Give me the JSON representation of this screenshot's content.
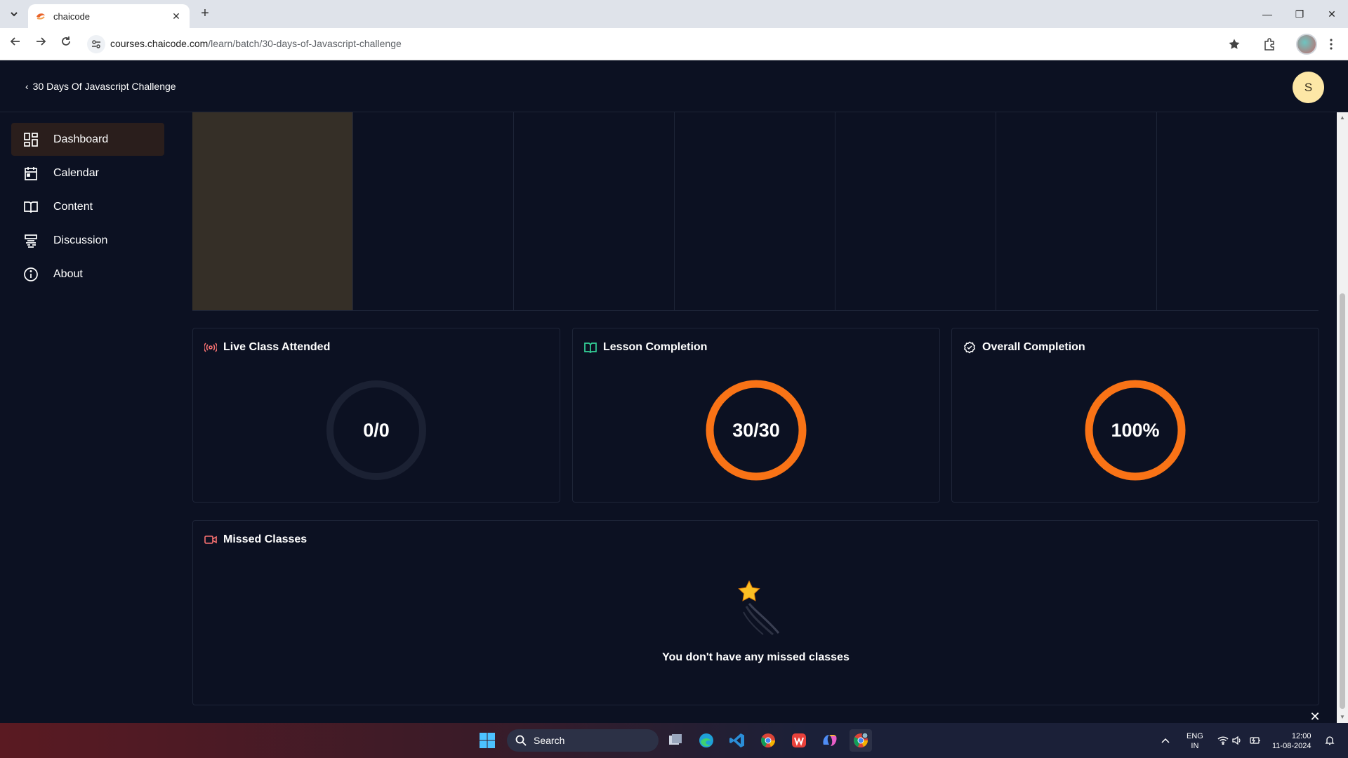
{
  "browser": {
    "tab_title": "chaicode",
    "url_host": "courses.chaicode.com",
    "url_path": "/learn/batch/30-days-of-Javascript-challenge"
  },
  "header": {
    "back_label": "30 Days Of Javascript Challenge",
    "avatar_initial": "S"
  },
  "sidebar": {
    "items": [
      {
        "label": "Dashboard",
        "icon": "dashboard-icon",
        "active": true
      },
      {
        "label": "Calendar",
        "icon": "calendar-icon",
        "active": false
      },
      {
        "label": "Content",
        "icon": "book-icon",
        "active": false
      },
      {
        "label": "Discussion",
        "icon": "discussion-icon",
        "active": false
      },
      {
        "label": "About",
        "icon": "info-icon",
        "active": false
      }
    ]
  },
  "stats": [
    {
      "title": "Live Class Attended",
      "value": "0/0",
      "progress": 0,
      "icon": "live-broadcast-icon",
      "icon_color": "#f87171"
    },
    {
      "title": "Lesson Completion",
      "value": "30/30",
      "progress": 1,
      "icon": "book-open-icon",
      "icon_color": "#34d399"
    },
    {
      "title": "Overall Completion",
      "value": "100%",
      "progress": 1,
      "icon": "badge-check-icon",
      "icon_color": "#ffffff"
    }
  ],
  "missed": {
    "title": "Missed Classes",
    "empty_text": "You don't have any missed classes"
  },
  "taskbar": {
    "search_label": "Search",
    "lang_1": "ENG",
    "lang_2": "IN",
    "time": "12:00",
    "date": "11-08-2024"
  },
  "colors": {
    "accent": "#f97316",
    "ring_track": "#1b2133",
    "background": "#0c1122",
    "active_item": "#2a1e1c"
  }
}
